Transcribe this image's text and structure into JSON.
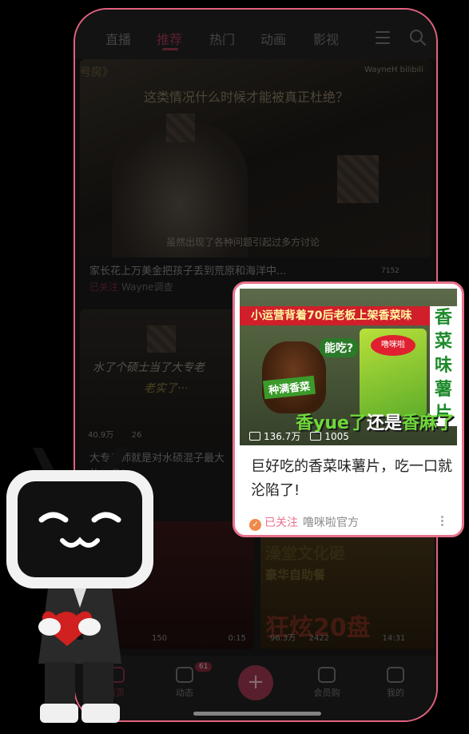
{
  "top_nav": {
    "tabs": [
      "直播",
      "推荐",
      "热门",
      "动画",
      "影视"
    ],
    "active_tab": "推荐"
  },
  "video_1": {
    "corner_text": "号房》",
    "overlay_title": "这类情况什么时候才能被真正杜绝？",
    "brand_text": "WayneH bilibili",
    "subtitle": "虽然出现了各种问题引起过多方讨论",
    "title": "家长花上万美金把孩子丢到荒原和海洋中...",
    "follow_label": "已关注",
    "author": "Wayne调查",
    "likes": "7152"
  },
  "video_2": {
    "caption_1": "水了个硕士当了大专老",
    "caption_2": "老实了···",
    "views": "40.9万",
    "comments": "26",
    "title": "大专老师就是对水硕混子最大的奖励！"
  },
  "video_3": {
    "views": "150",
    "duration": "0:15"
  },
  "video_4": {
    "text_1": "澡堂文化砸",
    "text_2": "豪华自助餐",
    "text_3": "狂炫20盘",
    "views": "96.3万",
    "comments": "2422",
    "duration": "14:31"
  },
  "bottom_nav": {
    "items": [
      "首页",
      "动态",
      "会员购",
      "我的"
    ],
    "badge": "61",
    "plus": "+"
  },
  "highlight_card": {
    "banner": "小运营背着70后老板上架香菜味",
    "side_text": [
      "香",
      "菜",
      "味",
      "薯",
      "片"
    ],
    "bubble_1": "能吃?",
    "chips_logo": "噜咪啦",
    "bubble_2": "种满香菜",
    "bottom_text_1": "香yue了",
    "bottom_text_2": "还是",
    "bottom_text_3": "香麻了",
    "views": "136.7万",
    "comments": "1005",
    "title": "巨好吃的香菜味薯片，吃一口就沦陷了!",
    "follow_label": "已关注",
    "author": "噜咪啦官方"
  }
}
